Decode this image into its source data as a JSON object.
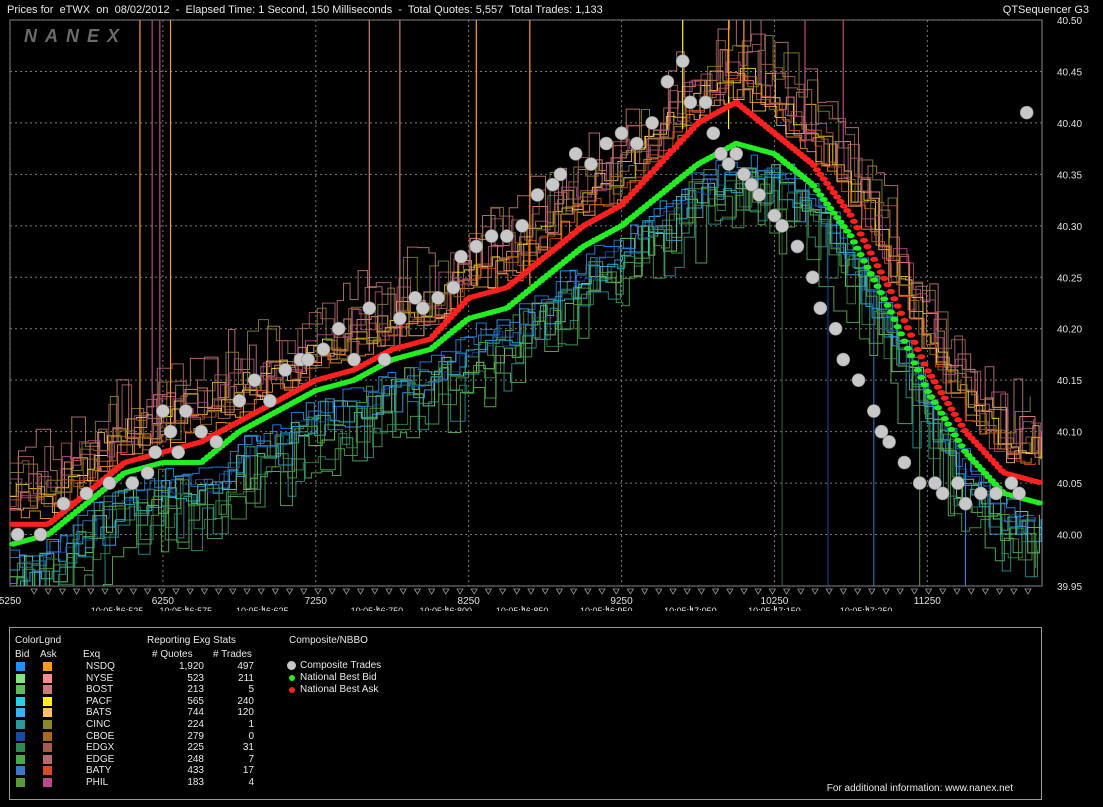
{
  "header": {
    "title": "Prices for  eTWX  on  08/02/2012  -  Elapsed Time: 1 Second, 150 Milliseconds  -  Total Quotes: 5,557  Total Trades: 1,133",
    "app_name": "QTSequencer G3",
    "watermark": "NANEX"
  },
  "chart_data": {
    "type": "line",
    "title": "Prices for  eTWX  on  08/02/2012",
    "y_ticks": [
      "40.50",
      "40.45",
      "40.40",
      "40.35",
      "40.30",
      "40.25",
      "40.20",
      "40.15",
      "40.10",
      "40.05",
      "40.00",
      "39.95"
    ],
    "x_seq_ticks": [
      "5250",
      "6250",
      "7250",
      "8250",
      "9250",
      "10250",
      "11250"
    ],
    "x_time_ticks": [
      "10:05:46:525",
      "10:05:46:575",
      "10:05:46:625",
      "10:05:46:750",
      "10:05:46:800",
      "10:05:46:850",
      "10:05:46:950",
      "10:05:47:050",
      "10:05:47:150",
      "10:05:47:250"
    ],
    "ylim": [
      39.95,
      40.5
    ],
    "xlim": [
      5250,
      12000
    ],
    "grid": true,
    "series": [
      {
        "name": "National Best Bid",
        "color": "#22ee22",
        "x": [
          5250,
          5500,
          5750,
          6000,
          6250,
          6500,
          6750,
          7000,
          7250,
          7500,
          7750,
          8000,
          8250,
          8500,
          8750,
          9000,
          9250,
          9500,
          9750,
          10000,
          10250,
          10500,
          10750,
          11000,
          11250,
          11500,
          11750,
          12000
        ],
        "y": [
          39.99,
          40.0,
          40.03,
          40.06,
          40.07,
          40.07,
          40.1,
          40.12,
          40.14,
          40.15,
          40.17,
          40.18,
          40.21,
          40.22,
          40.25,
          40.28,
          40.3,
          40.33,
          40.36,
          40.38,
          40.37,
          40.34,
          40.29,
          40.22,
          40.14,
          40.08,
          40.04,
          40.03
        ]
      },
      {
        "name": "National Best Ask",
        "color": "#ff2020",
        "x": [
          5250,
          5500,
          5750,
          6000,
          6250,
          6500,
          6750,
          7000,
          7250,
          7500,
          7750,
          8000,
          8250,
          8500,
          8750,
          9000,
          9250,
          9500,
          9750,
          10000,
          10250,
          10500,
          10750,
          11000,
          11250,
          11500,
          11750,
          12000
        ],
        "y": [
          40.01,
          40.01,
          40.04,
          40.07,
          40.08,
          40.09,
          40.11,
          40.13,
          40.15,
          40.16,
          40.18,
          40.19,
          40.23,
          40.24,
          40.27,
          40.3,
          40.32,
          40.36,
          40.4,
          40.42,
          40.39,
          40.36,
          40.31,
          40.24,
          40.16,
          40.1,
          40.06,
          40.05
        ]
      },
      {
        "name": "Composite Trades",
        "color": "#c8c8c8",
        "x": [
          5300,
          5450,
          5600,
          5750,
          5900,
          6050,
          6150,
          6200,
          6250,
          6300,
          6350,
          6400,
          6500,
          6600,
          6750,
          6850,
          6950,
          7050,
          7150,
          7200,
          7300,
          7400,
          7500,
          7600,
          7700,
          7800,
          7900,
          7950,
          8050,
          8150,
          8200,
          8300,
          8400,
          8500,
          8600,
          8700,
          8800,
          8850,
          8950,
          9050,
          9150,
          9250,
          9350,
          9450,
          9550,
          9650,
          9700,
          9800,
          9850,
          9900,
          9950,
          10000,
          10050,
          10100,
          10150,
          10250,
          10300,
          10400,
          10500,
          10550,
          10650,
          10700,
          10800,
          10900,
          10950,
          11000,
          11100,
          11200,
          11300,
          11350,
          11450,
          11500,
          11600,
          11700,
          11800,
          11850,
          11900
        ],
        "y": [
          40.0,
          40.0,
          40.03,
          40.04,
          40.05,
          40.05,
          40.06,
          40.08,
          40.12,
          40.1,
          40.08,
          40.12,
          40.1,
          40.09,
          40.13,
          40.15,
          40.13,
          40.16,
          40.17,
          40.17,
          40.18,
          40.2,
          40.17,
          40.22,
          40.17,
          40.21,
          40.23,
          40.22,
          40.23,
          40.24,
          40.27,
          40.28,
          40.29,
          40.29,
          40.3,
          40.33,
          40.34,
          40.35,
          40.37,
          40.36,
          40.38,
          40.39,
          40.38,
          40.4,
          40.44,
          40.46,
          40.42,
          40.42,
          40.39,
          40.37,
          40.36,
          40.37,
          40.35,
          40.34,
          40.33,
          40.31,
          40.3,
          40.28,
          40.25,
          40.22,
          40.2,
          40.17,
          40.15,
          40.12,
          40.1,
          40.09,
          40.07,
          40.05,
          40.05,
          40.04,
          40.05,
          40.03,
          40.04,
          40.04,
          40.05,
          40.04,
          40.41
        ]
      }
    ]
  },
  "legend": {
    "colorlgnd": "ColorLgnd",
    "bid": "Bid",
    "ask": "Ask",
    "exq": "Exq",
    "reporting": "Reporting Exg Stats",
    "quotes_h": "# Quotes",
    "trades_h": "# Trades",
    "composite_h": "Composite/NBBO",
    "comp_trades": "Composite Trades",
    "nbb": "National Best Bid",
    "nba": "National Best Ask",
    "footer": "For additional information: www.nanex.net",
    "rows": [
      {
        "exq": "NSDQ",
        "quotes": "1,920",
        "trades": "497",
        "bid": "#1e90ff",
        "ask": "#ff9a1a"
      },
      {
        "exq": "NYSE",
        "quotes": "523",
        "trades": "211",
        "bid": "#7ee87e",
        "ask": "#ff8c8c"
      },
      {
        "exq": "BOST",
        "quotes": "213",
        "trades": "5",
        "bid": "#5dbb5d",
        "ask": "#cc7a7a"
      },
      {
        "exq": "PACF",
        "quotes": "565",
        "trades": "240",
        "bid": "#22d0e8",
        "ask": "#ffee22"
      },
      {
        "exq": "BATS",
        "quotes": "744",
        "trades": "120",
        "bid": "#3ab0ff",
        "ask": "#ffc060"
      },
      {
        "exq": "CINC",
        "quotes": "224",
        "trades": "1",
        "bid": "#2a9a9a",
        "ask": "#8a8a22"
      },
      {
        "exq": "CBOE",
        "quotes": "279",
        "trades": "0",
        "bid": "#1a4aa8",
        "ask": "#a86a1a"
      },
      {
        "exq": "EDGX",
        "quotes": "225",
        "trades": "31",
        "bid": "#2e8a4e",
        "ask": "#a85a4a"
      },
      {
        "exq": "EDGE",
        "quotes": "248",
        "trades": "7",
        "bid": "#4aa84a",
        "ask": "#b86a6a"
      },
      {
        "exq": "BATY",
        "quotes": "433",
        "trades": "17",
        "bid": "#3a7ac8",
        "ask": "#d84a22"
      },
      {
        "exq": "PHIL",
        "quotes": "183",
        "trades": "4",
        "bid": "#5a9a3a",
        "ask": "#b84a8a"
      }
    ]
  }
}
